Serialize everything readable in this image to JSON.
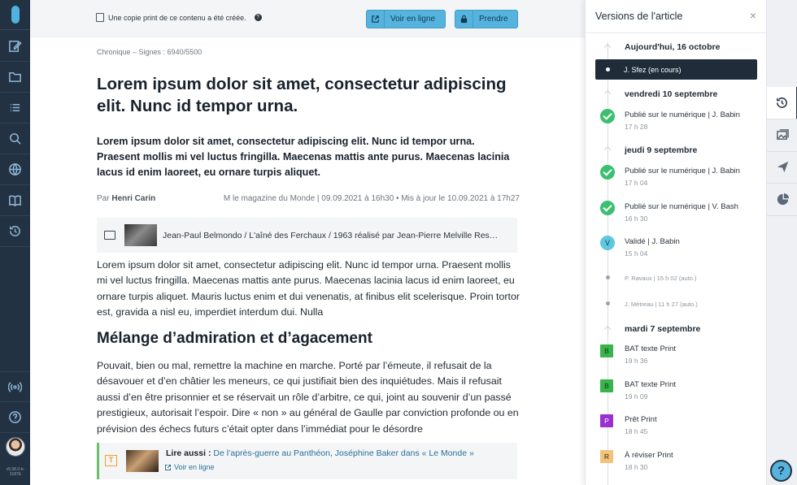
{
  "topbar": {
    "copy_notice": "Une copie print de ce contenu a été créée.",
    "help_glyph": "?",
    "view_online_label": "Voir en ligne",
    "take_label": "Prendre"
  },
  "article": {
    "kicker": "Chronique – Signes : 6940/5500",
    "title": "Lorem ipsum dolor sit amet, consectetur adipiscing elit. Nunc id tempor urna.",
    "lead": "Lorem ipsum dolor sit amet, consectetur adipiscing elit. Nunc id tempor urna. Praesent mollis mi vel luctus fringilla. Maecenas mattis ante purus. Maecenas lacinia lacus id enim laoreet, eu ornare turpis aliquet.",
    "by_prefix": "Par",
    "author": "Henri Carin",
    "publication": "M le magazine du Monde | 09.09.2021 à 16h30 • Mis à jour le 10.09.2021 à 17h27",
    "media_caption": "Jean-Paul Belmondo / L'aîné des Ferchaux / 1963 réalisé par Jean-Pierre Melville Res…",
    "paragraph1": "Lorem ipsum dolor sit amet, consectetur adipiscing elit. Nunc id tempor urna. Praesent mollis mi vel luctus fringilla. Maecenas mattis ante purus. Maecenas lacinia lacus id enim laoreet, eu ornare turpis aliquet. Mauris luctus enim et dui venenatis, at finibus elit scelerisque. Proin tortor est, gravida a nisl eu, imperdiet interdum dui. Nulla",
    "subheading": "Mélange d’admiration et d’agacement",
    "paragraph2": "Pouvait, bien ou mal, remettre la machine en marche. Porté par l’émeute, il refusait de la désavouer et d’en châtier les meneurs, ce qui justifiait bien des inquiétudes. Mais il refusait aussi d’en être prisonnier et se réservait un rôle d’arbitre, ce qui, joint au souvenir d’un passé prestigieux, autorisait l’espoir. Dire « non » au général de Gaulle par conviction profonde ou en prévision des échecs futurs c’était opter dans l’immédiat pour le désordre",
    "read_also_label": "Lire aussi :",
    "read_also_link": "De l’après-guerre au Panthéon, Joséphine Baker dans « Le Monde »",
    "read_also_online": "Voir en ligne",
    "read_also_glyph": "T"
  },
  "rail": {
    "version": "v5.58.0-b-3187E"
  },
  "panel": {
    "title": "Versions de l'article",
    "close_glyph": "×",
    "days": [
      "Aujourd'hui, 16 octobre",
      "vendredi 10 septembre",
      "jeudi 9 septembre",
      "mardi 7 septembre"
    ],
    "current": "J. Sfez (en cours)",
    "entries": [
      {
        "label": "Publié sur le numérique | J. Babin",
        "time": "17 h 28"
      },
      {
        "label": "Publié sur le numérique | J. Babin",
        "time": "17 h 04"
      },
      {
        "label": "Publié sur le numérique | V. Bash",
        "time": "16 h 30"
      },
      {
        "label": "Validé | J. Babin",
        "time": "15 h 04"
      },
      {
        "label": "BAT texte Print",
        "time": "19 h 36"
      },
      {
        "label": "BAT texte Print",
        "time": "19 h 09"
      },
      {
        "label": "Prêt Print",
        "time": "18 h 45"
      },
      {
        "label": "À réviser Print",
        "time": "18 h 30"
      }
    ],
    "auto1": "P. Ravaux | 15 h 02 (auto.)",
    "auto2": "J. Métreau | 11 h 27 (auto.)",
    "badges": {
      "validated": "V",
      "bat": "B",
      "ready": "P",
      "review": "R"
    },
    "colors": {
      "bat": "#38b54a",
      "ready": "#9b2fd0",
      "review": "#f3c27a",
      "check": "#3cbf6e",
      "validated": "#5fc7df"
    }
  },
  "help_fab": "?"
}
